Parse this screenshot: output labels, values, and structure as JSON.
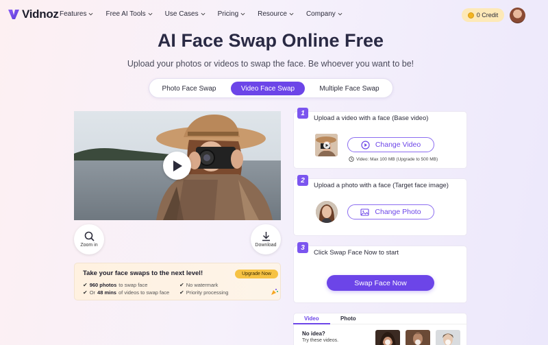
{
  "nav": {
    "logo": "Vidnoz",
    "menu": [
      "Features",
      "Free AI Tools",
      "Use Cases",
      "Pricing",
      "Resource",
      "Company"
    ],
    "credit": "0 Credit"
  },
  "hero": {
    "title": "AI Face Swap Online Free",
    "subtitle": "Upload your photos or videos to swap the face. Be whoever you want to be!"
  },
  "tabs": [
    {
      "label": "Photo Face Swap",
      "active": false
    },
    {
      "label": "Video Face Swap",
      "active": true
    },
    {
      "label": "Multiple Face Swap",
      "active": false
    }
  ],
  "preview": {
    "zoom_label": "Zoom in",
    "download_label": "Download"
  },
  "promo": {
    "title": "Take your face swaps to the next level!",
    "upgrade": "Upgrade Now",
    "f1_bold": "960 photos",
    "f1_rest": " to swap face",
    "f2_pre": "Or ",
    "f2_bold": "48 mins",
    "f2_rest": " of videos to swap face",
    "f3": "No watermark",
    "f4": "Priority processing"
  },
  "steps": {
    "s1_num": "1",
    "s1_text": "Upload a video with a face (Base video)",
    "s1_button": "Change Video",
    "s1_note": "Video: Max 100 MB (Upgrade to 500 MB)",
    "s2_num": "2",
    "s2_text": "Upload a photo with a face (Target face image)",
    "s2_button": "Change Photo",
    "s3_num": "3",
    "s3_text": "Click Swap Face Now to start",
    "s3_button": "Swap Face Now"
  },
  "samples": {
    "tab_video": "Video",
    "tab_photo": "Photo",
    "no_idea": "No idea?",
    "try": "Try these videos."
  },
  "colors": {
    "accent": "#6c45e8",
    "upgrade": "#f6c243",
    "credit_bg": "#fde9b8"
  }
}
